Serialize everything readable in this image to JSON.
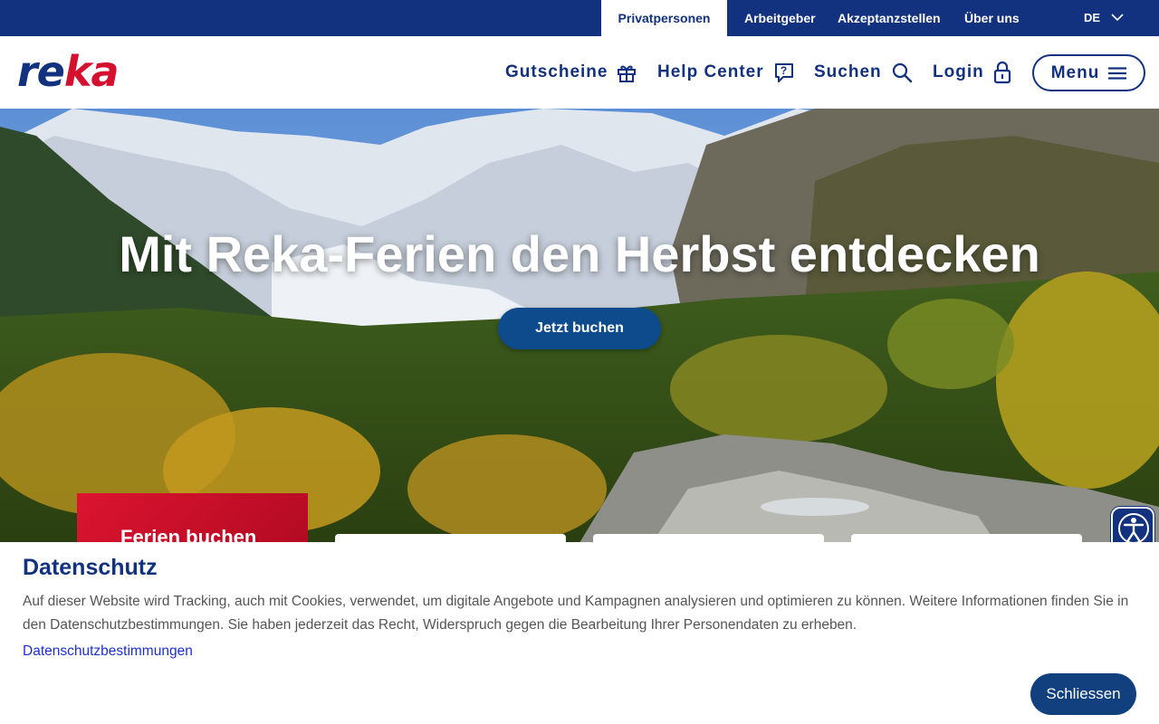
{
  "topbar": {
    "tabs": [
      {
        "label": "Privatpersonen",
        "active": true
      },
      {
        "label": "Arbeitgeber",
        "active": false
      },
      {
        "label": "Akzeptanzstellen",
        "active": false
      },
      {
        "label": "Über uns",
        "active": false
      }
    ],
    "language": "DE"
  },
  "header": {
    "logo": {
      "part1": "re",
      "part2": "ka"
    },
    "nav": [
      {
        "label": "Gutscheine",
        "icon": "gift-icon"
      },
      {
        "label": "Help Center",
        "icon": "help-bubble-icon"
      },
      {
        "label": "Suchen",
        "icon": "search-icon"
      },
      {
        "label": "Login",
        "icon": "lock-icon"
      }
    ],
    "menu_label": "Menu"
  },
  "hero": {
    "title": "Mit Reka-Ferien den Herbst entdecken",
    "cta": "Jetzt buchen",
    "book_card": "Ferien buchen"
  },
  "cookie": {
    "title": "Datenschutz",
    "text": "Auf dieser Website wird Tracking, auch mit Cookies, verwendet, um digitale Angebote und Kampagnen analysieren und optimieren zu können. Weitere Informationen finden Sie in den Datenschutzbestimmungen. Sie haben jederzeit das Recht, Widerspruch gegen die Bearbeitung Ihrer Personendaten zu erheben.",
    "link": "Datenschutzbestimmungen",
    "close": "Schliessen"
  },
  "colors": {
    "brand_blue": "#12317f",
    "brand_red": "#d5102e",
    "button_blue": "#0d4b8c"
  }
}
